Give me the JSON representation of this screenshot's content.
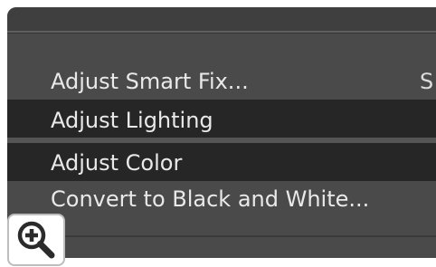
{
  "menu": {
    "items": [
      {
        "label": "Adjust Smart Fix...",
        "shortcut": "S",
        "highlighted": false
      },
      {
        "label": "Adjust Lighting",
        "highlighted": true
      },
      {
        "label": "Adjust Color",
        "highlighted": true
      },
      {
        "label": "Convert to Black and White...",
        "highlighted": false
      }
    ]
  },
  "zoom_button": {
    "icon": "zoom-in-icon"
  },
  "colors": {
    "menu_background": "#4a4a4a",
    "highlight_background": "#262626",
    "text": "#e9e9e9"
  }
}
